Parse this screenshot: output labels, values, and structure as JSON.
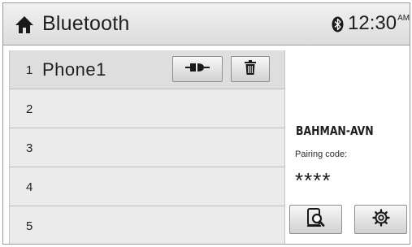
{
  "header": {
    "title": "Bluetooth",
    "home_icon": "home-icon",
    "status_icon": "bluetooth-icon",
    "time": "12:30",
    "ampm": "AM"
  },
  "device_list": [
    {
      "number": "1",
      "name": "Phone1",
      "actions": [
        "connect-icon",
        "trash-icon"
      ]
    },
    {
      "number": "2",
      "name": ""
    },
    {
      "number": "3",
      "name": ""
    },
    {
      "number": "4",
      "name": ""
    },
    {
      "number": "5",
      "name": ""
    }
  ],
  "info_panel": {
    "device_name": "BAHMAN-AVN",
    "pairing_code_label": "Pairing code:",
    "pairing_code": "****",
    "buttons": [
      "search-device-icon",
      "settings-icon"
    ]
  }
}
